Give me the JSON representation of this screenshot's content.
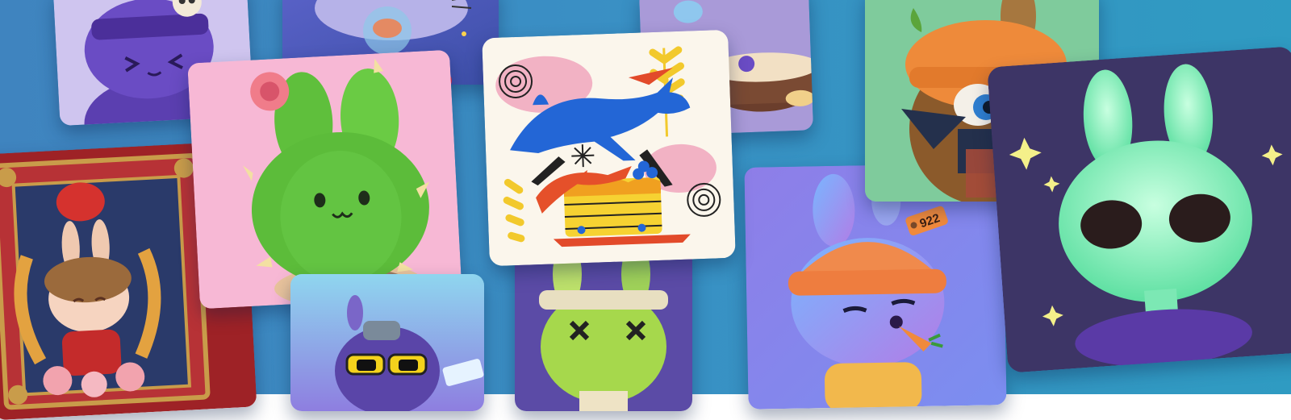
{
  "collage": {
    "background_color": "#3a8fc4",
    "cards": [
      {
        "id": "purple-skull-bunny",
        "icon": "purple-bunny-skull-hat"
      },
      {
        "id": "bubble-bunny",
        "icon": "bunny-glass-dome"
      },
      {
        "id": "cactus-bunny",
        "icon": "cactus-bunny-rose"
      },
      {
        "id": "lunar-new-year-bunny",
        "icon": "bunny-lantern-shrine"
      },
      {
        "id": "rabbit-illustration",
        "icon": "leaping-rabbits-pancake"
      },
      {
        "id": "cake-bunny",
        "icon": "bunny-on-cake"
      },
      {
        "id": "carrot-hat-bunny",
        "icon": "carrot-hat-bandana-bunny"
      },
      {
        "id": "alien-bunny",
        "icon": "glowing-alien-bunny-ufo"
      },
      {
        "id": "beanie-bunny",
        "icon": "beanie-bunny-carrot"
      },
      {
        "id": "zombie-bunny",
        "icon": "stitched-zombie-bunny"
      },
      {
        "id": "sunglasses-bunny",
        "icon": "cool-bunny-sunglasses"
      }
    ],
    "beanie_bunny_tag": "922"
  }
}
